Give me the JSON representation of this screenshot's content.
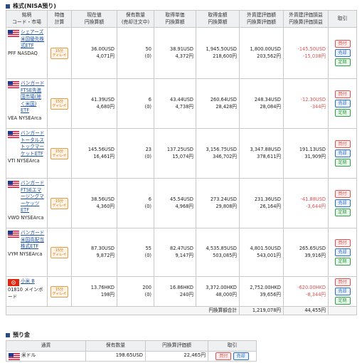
{
  "stocks_section": {
    "title": "株式(NISA預り)",
    "headers": {
      "name": [
        "銘柄",
        "コード・市場"
      ],
      "timing": [
        "時価",
        "計算"
      ],
      "price": [
        "現在値",
        "円換算額"
      ],
      "qty": [
        "保有数量",
        "(売却注文中)"
      ],
      "cost_unit": [
        "取得単価",
        "円換算額"
      ],
      "cost_total": [
        "取得金額",
        "円換算額"
      ],
      "valuation": [
        "外貨建評価額",
        "円換算評価額"
      ],
      "pnl": [
        "外貨建評価損益",
        "円換算評価損益"
      ],
      "trade": [
        "取引"
      ]
    },
    "rows": [
      {
        "flag": "us",
        "name": "シェアーズ 米国優先株式ETF",
        "code": "PFF NASDAQ",
        "delay": [
          "15分",
          "ディレイ"
        ],
        "price": "36.00USD",
        "price_jpy": "4,071円",
        "qty": "50",
        "qty_pending": "(0)",
        "cost_unit": "38.91USD",
        "cost_unit_jpy": "4,372円",
        "cost_total": "1,945.50USD",
        "cost_total_jpy": "218,600円",
        "valuation": "1,800.00USD",
        "valuation_jpy": "203,562円",
        "pnl": "-145.50USD",
        "pnl_jpy": "-15,038円",
        "pnl_neg": true
      },
      {
        "flag": "us",
        "name": "バンガード FTSE先進国市場(除く米国) ETF",
        "code": "VEA NYSEArca",
        "delay": [
          "15分",
          "ディレイ"
        ],
        "price": "41.39USD",
        "price_jpy": "4,680円",
        "qty": "6",
        "qty_pending": "(0)",
        "cost_unit": "43.44USD",
        "cost_unit_jpy": "4,738円",
        "cost_total": "260.64USD",
        "cost_total_jpy": "28,428円",
        "valuation": "248.34USD",
        "valuation_jpy": "28,084円",
        "pnl": "-12.30USD",
        "pnl_jpy": "-344円",
        "pnl_neg": true
      },
      {
        "flag": "us",
        "name": "バンガード トータルストックマーケットETF",
        "code": "VTI NYSEArca",
        "delay": [
          "15分",
          "ディレイ"
        ],
        "price": "145.56USD",
        "price_jpy": "16,461円",
        "qty": "23",
        "qty_pending": "(0)",
        "cost_unit": "137.25USD",
        "cost_unit_jpy": "15,074円",
        "cost_total": "3,156.75USD",
        "cost_total_jpy": "346,702円",
        "valuation": "3,347.88USD",
        "valuation_jpy": "378,611円",
        "pnl": "191.13USD",
        "pnl_jpy": "31,909円",
        "pnl_neg": false
      },
      {
        "flag": "us",
        "name": "バンガード FTSEエマージングマーケッツETF",
        "code": "VWO NYSEArca",
        "delay": [
          "15分",
          "ディレイ"
        ],
        "price": "38.56USD",
        "price_jpy": "4,360円",
        "qty": "6",
        "qty_pending": "(0)",
        "cost_unit": "45.54USD",
        "cost_unit_jpy": "4,968円",
        "cost_total": "273.24USD",
        "cost_total_jpy": "29,808円",
        "valuation": "231.36USD",
        "valuation_jpy": "26,164円",
        "pnl": "-41.88USD",
        "pnl_jpy": "-3,644円",
        "pnl_neg": true
      },
      {
        "flag": "us",
        "name": "バンガード 米国高配当株式ETF",
        "code": "VYM NYSEArca",
        "delay": [
          "15分",
          "ディレイ"
        ],
        "price": "87.30USD",
        "price_jpy": "9,872円",
        "qty": "55",
        "qty_pending": "(0)",
        "cost_unit": "82.47USD",
        "cost_unit_jpy": "9,147円",
        "cost_total": "4,535.85USD",
        "cost_total_jpy": "503,085円",
        "valuation": "4,801.50USD",
        "valuation_jpy": "543,001円",
        "pnl": "265.65USD",
        "pnl_jpy": "39,916円",
        "pnl_neg": false
      },
      {
        "flag": "hk",
        "name": "小米 B",
        "code": "01810 メインボード",
        "delay": [
          "15分",
          "ディレイ"
        ],
        "price": "13.76HKD",
        "price_jpy": "198円",
        "qty": "200",
        "qty_pending": "(0)",
        "cost_unit": "16.86HKD",
        "cost_unit_jpy": "240円",
        "cost_total": "3,372.00HKD",
        "cost_total_jpy": "48,000円",
        "valuation": "2,752.00HKD",
        "valuation_jpy": "39,656円",
        "pnl": "-620.00HKD",
        "pnl_jpy": "-8,344円",
        "pnl_neg": true
      }
    ],
    "trade_labels": {
      "buy": "買付",
      "sell": "売却",
      "fixed": "定期"
    },
    "total": {
      "label": "円換算額合計",
      "valuation": "1,219,078円",
      "pnl": "44,455円"
    }
  },
  "cash_section": {
    "title": "預り金",
    "headers": [
      "通貨",
      "保有数量",
      "円換算評価額",
      "取引"
    ],
    "rows": [
      {
        "flag": "us",
        "currency": "米ドル",
        "qty": "198.65USD",
        "valuation": "22,465円",
        "buy": "買付",
        "sell": "売却"
      }
    ]
  },
  "colors": {
    "link": "#1a4fa8",
    "negative": "#d9534f",
    "buy": "#d9534f",
    "sell": "#2e6bc4",
    "fixed": "#2f9e44",
    "delay": "#d96a00"
  }
}
